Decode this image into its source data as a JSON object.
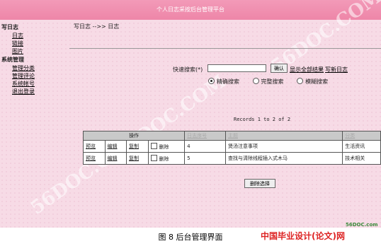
{
  "header": {
    "title": "个人日志采按后台管理平台"
  },
  "watermark": "56DOC.COM",
  "sidebar": {
    "sections": [
      {
        "label": "写日志",
        "items": [
          "日志",
          "链接",
          "图片"
        ]
      },
      {
        "label": "系统管理",
        "items": [
          "管理分类",
          "管理评论",
          "系统帐号",
          "退出登录"
        ]
      }
    ]
  },
  "breadcrumb": "写日志 -->> 日志",
  "search": {
    "label": "快速搜索(*)",
    "value": "",
    "confirm": "确认",
    "show_all": "显示全部结果",
    "write_new": "写新日志",
    "options": [
      {
        "label": "精确搜索",
        "selected": true
      },
      {
        "label": "完整搜索",
        "selected": false
      },
      {
        "label": "模糊搜索",
        "selected": false
      }
    ]
  },
  "records": "Records 1 to 2 of 2",
  "table": {
    "header_ops": "操作",
    "header_id": "日志序号",
    "header_title": "主题",
    "header_cat": "分类",
    "rows": [
      {
        "preview": "预览",
        "edit": "编辑",
        "copy": "复制",
        "del": "删除",
        "id": "4",
        "title": "煲汤注意事项",
        "cat": "生活资讯"
      },
      {
        "preview": "预览",
        "edit": "编辑",
        "copy": "复制",
        "del": "删除",
        "id": "5",
        "title": "查找与清除线程插入式木马",
        "cat": "技术相关"
      }
    ]
  },
  "delete_selected": "删除选择",
  "caption": "图 8  后台管理界面",
  "logo_small": "56DOC.com",
  "logo": "中国毕业设计(论文)网"
}
